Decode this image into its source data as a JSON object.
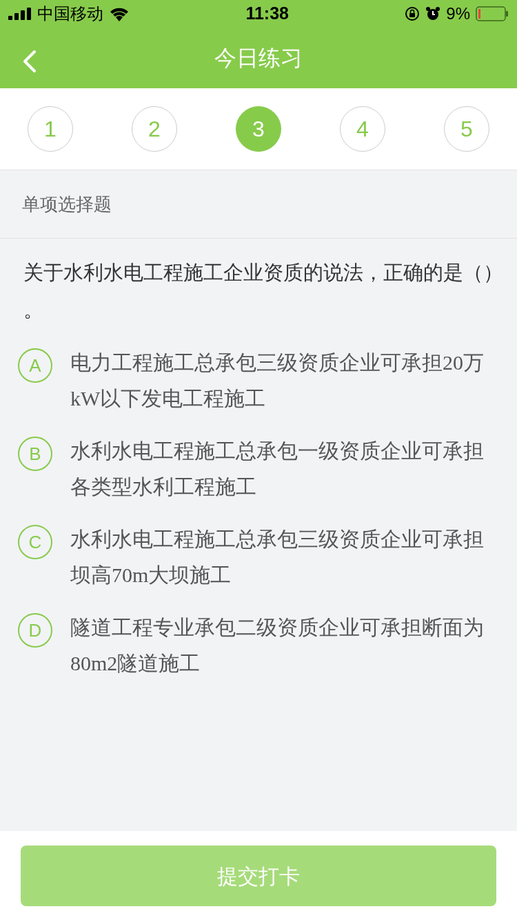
{
  "status_bar": {
    "carrier": "中国移动",
    "time": "11:38",
    "battery": "9%"
  },
  "header": {
    "title": "今日练习"
  },
  "steps": [
    {
      "label": "1",
      "selected": false
    },
    {
      "label": "2",
      "selected": false
    },
    {
      "label": "3",
      "selected": true
    },
    {
      "label": "4",
      "selected": false
    },
    {
      "label": "5",
      "selected": false
    }
  ],
  "question": {
    "type": "单项选择题",
    "text": "关于水利水电工程施工企业资质的说法，正确的是（）。"
  },
  "options": [
    {
      "letter": "A",
      "text": "电力工程施工总承包三级资质企业可承担20万kW以下发电工程施工",
      "selected": false
    },
    {
      "letter": "B",
      "text": "水利水电工程施工总承包一级资质企业可承担各类型水利工程施工",
      "selected": false
    },
    {
      "letter": "C",
      "text": "水利水电工程施工总承包三级资质企业可承担坝高70m大坝施工",
      "selected": false
    },
    {
      "letter": "D",
      "text": "隧道工程专业承包二级资质企业可承担断面为80m2隧道施工",
      "selected": false
    }
  ],
  "submit": {
    "label": "提交打卡",
    "disabled": true
  }
}
